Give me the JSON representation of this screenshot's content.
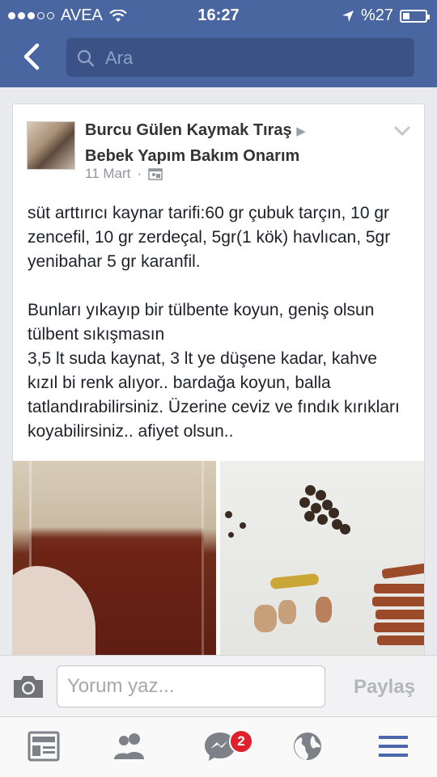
{
  "status_bar": {
    "carrier": "AVEA",
    "time": "16:27",
    "battery": "%27"
  },
  "search": {
    "placeholder": "Ara"
  },
  "post": {
    "author": "Burcu Gülen Kaymak Tıraş",
    "author_arrow": "▶",
    "page": "Bebek Yapım Bakım Onarım",
    "date": "11 Mart",
    "text": "süt arttırıcı kaynar tarifi:60 gr çubuk tarçın, 10 gr zencefil, 10 gr zerdeçal, 5gr(1 kök) havlıcan, 5gr yenibahar 5 gr karanfil.\n\nBunları yıkayıp bir tülbente koyun, geniş olsun tülbent sıkışmasın\n3,5 lt suda kaynat, 3 lt ye düşene kadar, kahve kızıl bi renk alıyor.. bardağa koyun, balla tatlandırabilirsiniz. Üzerine ceviz ve fındık kırıkları koyabilirsiniz.. afiyet olsun.."
  },
  "comment": {
    "placeholder": "Yorum yaz...",
    "share_label": "Paylaş"
  },
  "tabs": {
    "messages_badge": "2"
  },
  "colors": {
    "header_blue": "#4a66a0",
    "search_bg": "#3b5286",
    "active_tab": "#4a67ad",
    "badge_red": "#e0202c"
  }
}
